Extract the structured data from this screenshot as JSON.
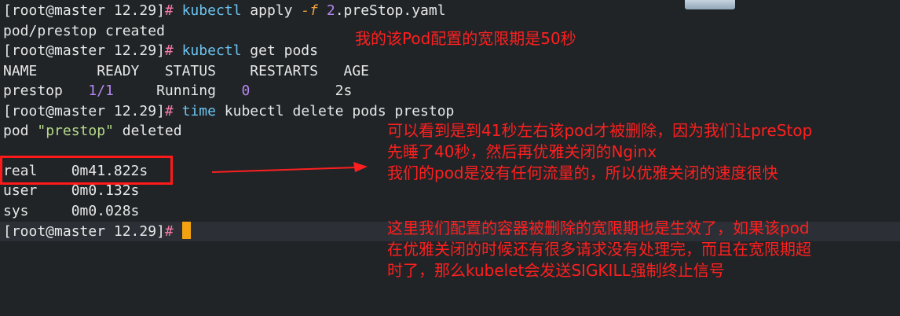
{
  "terminal": {
    "prompt": "[root@master 12.29]",
    "hash": "#",
    "lines": {
      "cmd1": {
        "cmd": "kubectl",
        "rest1": " apply ",
        "flag": "-f",
        "rest2": " ",
        "num": "2",
        "rest3": ".preStop.yaml"
      },
      "out1": "pod/prestop created",
      "cmd2": {
        "cmd": "kubectl",
        "rest": " get pods"
      },
      "header": "NAME       READY   STATUS    RESTARTS   AGE",
      "row": {
        "name": "prestop   ",
        "ready": "1/1",
        "mid": "     Running   ",
        "restarts": "0",
        "age": "          2s"
      },
      "cmd3": {
        "cmd": "time",
        "cmd2": " kubectl",
        "rest": " delete pods prestop"
      },
      "out2": {
        "pre": "pod ",
        "quoted": "\"prestop\"",
        "post": " deleted"
      },
      "real": "real    0m41.822s",
      "user": "user    0m0.132s",
      "sys": "sys     0m0.028s"
    }
  },
  "annotations": {
    "note1": "我的该Pod配置的宽限期是50秒",
    "note2": "可以看到是到41秒左右该pod才被删除，因为我们让preStop\n先睡了40秒，然后再优雅关闭的Nginx\n我们的pod是没有任何流量的，所以优雅关闭的速度很快",
    "note3": "这里我们配置的容器被删除的宽限期也是生效了，如果该pod\n在优雅关闭的时候还有很多请求没有处理完，而且在宽限期超\n时了，那么kubelet会发送SIGKILL强制终止信号"
  },
  "colors": {
    "background": "#202427",
    "annotation": "#ff1f1f",
    "cursor": "#f2a30f"
  }
}
